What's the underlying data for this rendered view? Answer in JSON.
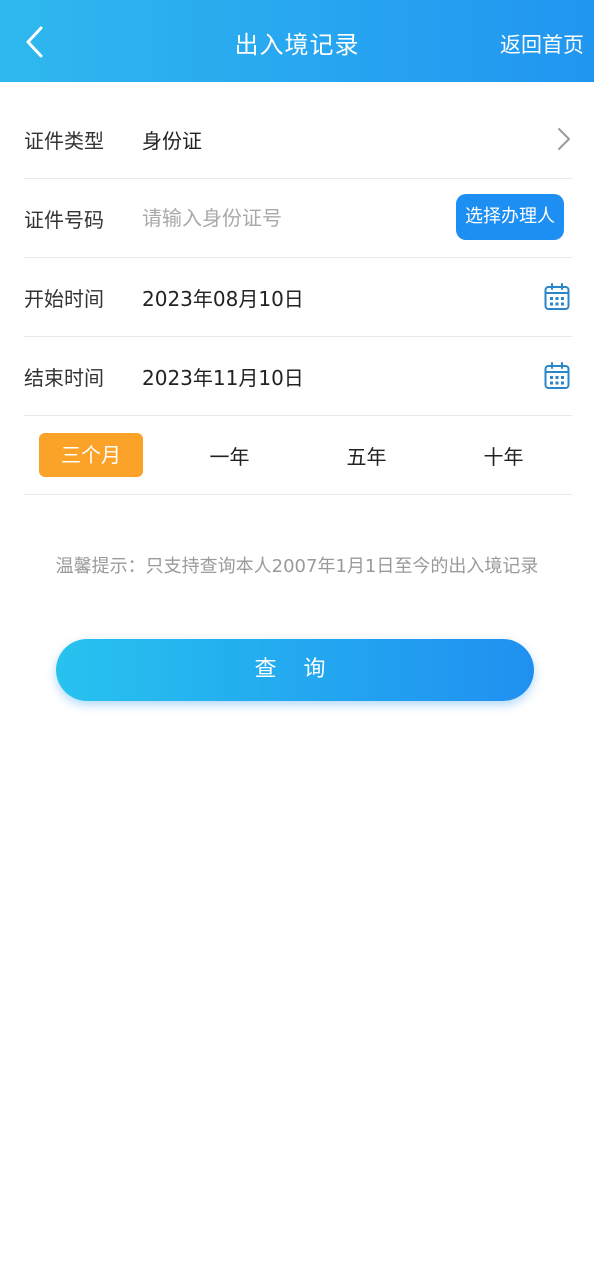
{
  "header": {
    "title": "出入境记录",
    "home_label": "返回首页"
  },
  "form": {
    "doc_type": {
      "label": "证件类型",
      "value": "身份证"
    },
    "doc_number": {
      "label": "证件号码",
      "value": "",
      "placeholder": "请输入身份证号",
      "select_button": "选择办理人"
    },
    "start_time": {
      "label": "开始时间",
      "value": "2023年08月10日"
    },
    "end_time": {
      "label": "结束时间",
      "value": "2023年11月10日"
    }
  },
  "periods": {
    "selected": "三个月",
    "items": [
      "三个月",
      "一年",
      "五年",
      "十年"
    ]
  },
  "tip": "温馨提示：只支持查询本人2007年1月1日至今的出入境记录",
  "query_button": "查 询",
  "colors": {
    "header_gradient_start": "#2fb8ef",
    "header_gradient_end": "#2196f0",
    "accent_blue": "#1e8ff2",
    "active_orange": "#fba229",
    "icon_blue": "#2a86c8"
  }
}
